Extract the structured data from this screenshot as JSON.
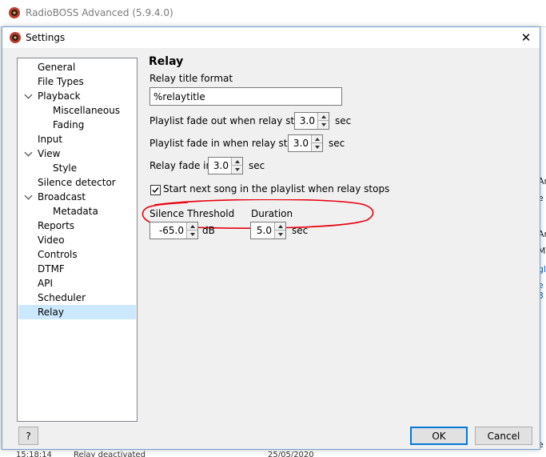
{
  "app": {
    "title": "RadioBOSS Advanced (5.9.4.0)"
  },
  "dialog": {
    "title": "Settings",
    "close_glyph": "✕"
  },
  "tree": {
    "items": [
      {
        "label": "General",
        "level": 0,
        "expanded": false,
        "selected": false
      },
      {
        "label": "File Types",
        "level": 0,
        "expanded": false,
        "selected": false
      },
      {
        "label": "Playback",
        "level": 0,
        "expanded": true,
        "selected": false
      },
      {
        "label": "Miscellaneous",
        "level": 1,
        "expanded": false,
        "selected": false
      },
      {
        "label": "Fading",
        "level": 1,
        "expanded": false,
        "selected": false
      },
      {
        "label": "Input",
        "level": 0,
        "expanded": false,
        "selected": false
      },
      {
        "label": "View",
        "level": 0,
        "expanded": true,
        "selected": false
      },
      {
        "label": "Style",
        "level": 1,
        "expanded": false,
        "selected": false
      },
      {
        "label": "Silence detector",
        "level": 0,
        "expanded": false,
        "selected": false
      },
      {
        "label": "Broadcast",
        "level": 0,
        "expanded": true,
        "selected": false
      },
      {
        "label": "Metadata",
        "level": 1,
        "expanded": false,
        "selected": false
      },
      {
        "label": "Reports",
        "level": 0,
        "expanded": false,
        "selected": false
      },
      {
        "label": "Video",
        "level": 0,
        "expanded": false,
        "selected": false
      },
      {
        "label": "Controls",
        "level": 0,
        "expanded": false,
        "selected": false
      },
      {
        "label": "DTMF",
        "level": 0,
        "expanded": false,
        "selected": false
      },
      {
        "label": "API",
        "level": 0,
        "expanded": false,
        "selected": false
      },
      {
        "label": "Scheduler",
        "level": 0,
        "expanded": false,
        "selected": false
      },
      {
        "label": "Relay",
        "level": 0,
        "expanded": false,
        "selected": true
      }
    ]
  },
  "relay": {
    "section_title": "Relay",
    "title_format_label": "Relay title format",
    "title_format_value": "%relaytitle",
    "fade_out_label": "Playlist fade out when relay starts",
    "fade_out_value": "3.0",
    "fade_out_unit": "sec",
    "fade_in_label": "Playlist fade in when relay stops",
    "fade_in_value": "3.0",
    "fade_in_unit": "sec",
    "relay_fade_label": "Relay fade in",
    "relay_fade_value": "3.0",
    "relay_fade_unit": "sec",
    "start_next_label": "Start next song in the playlist when relay stops",
    "start_next_checked": true,
    "silence_threshold_label": "Silence Threshold",
    "silence_threshold_value": "-65.0",
    "silence_threshold_unit": "dB",
    "duration_label": "Duration",
    "duration_value": "5.0",
    "duration_unit": "sec"
  },
  "buttons": {
    "help": "?",
    "ok": "OK",
    "cancel": "Cancel"
  },
  "background": {
    "right_fragments": [
      "Ar",
      "e",
      "Ar",
      "M",
      "gl",
      "e 3",
      "e 3"
    ],
    "bottom_time": "15:18:14",
    "bottom_text": "Relay deactivated",
    "bottom_date": "25/05/2020"
  },
  "colors": {
    "selection": "#cce8ff",
    "annotation": "#e8000f",
    "default_button_border": "#0078d7"
  }
}
